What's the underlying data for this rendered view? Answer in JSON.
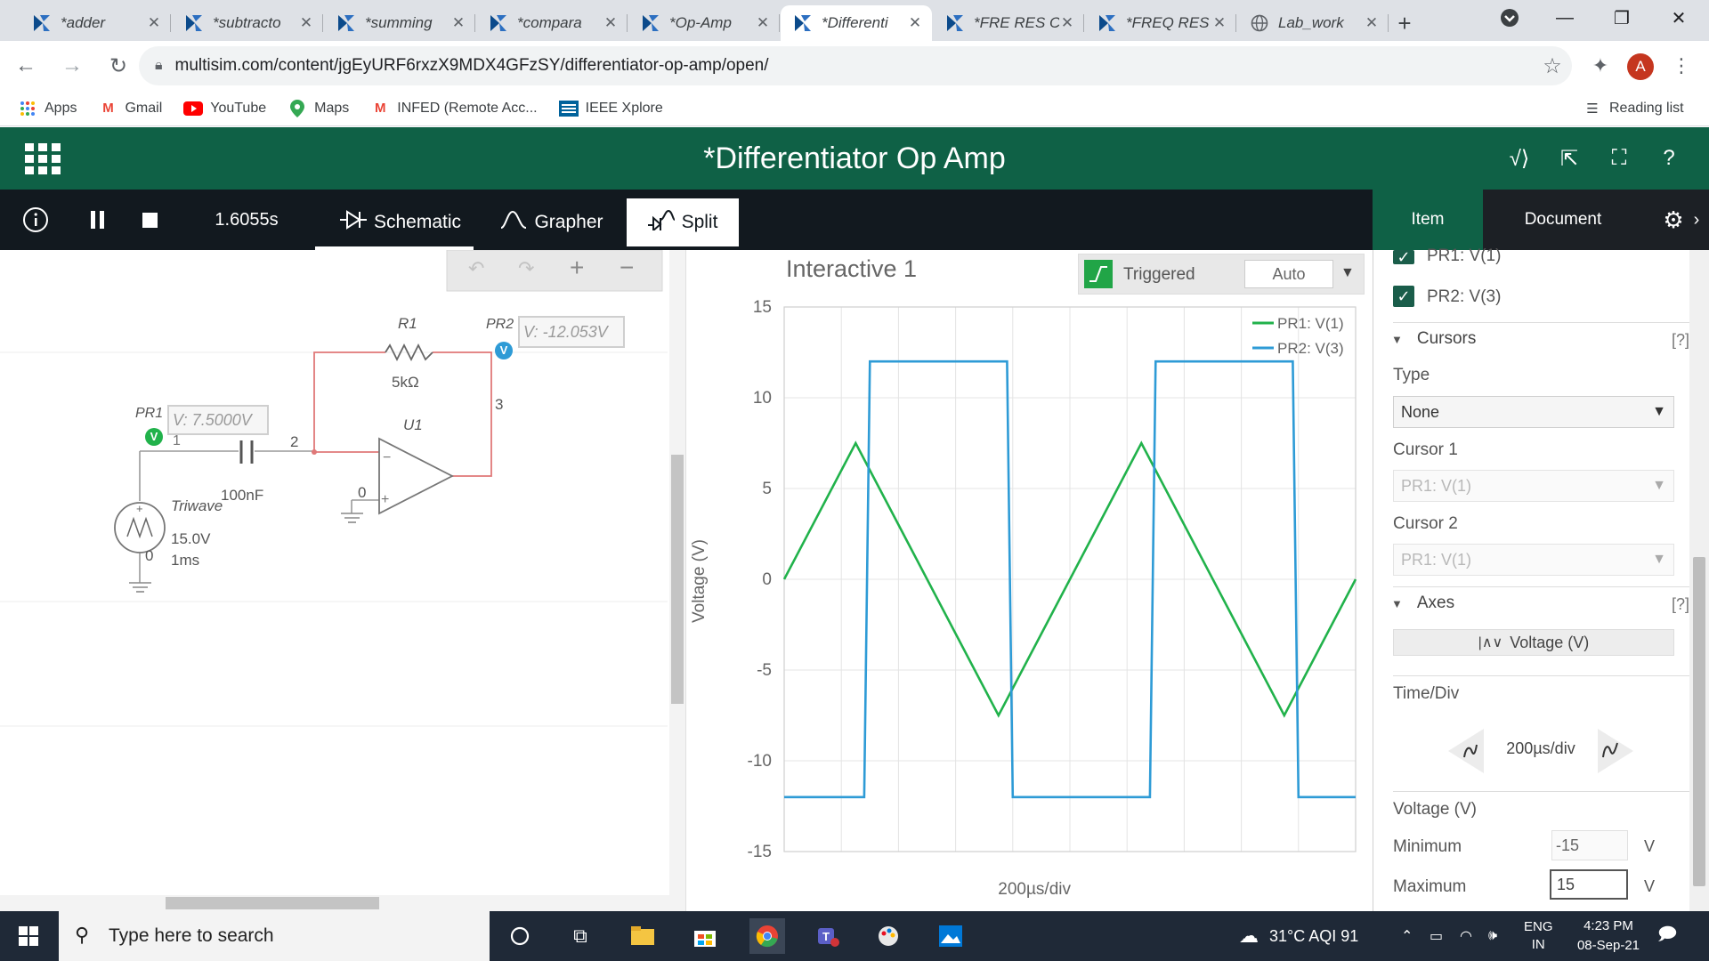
{
  "browser": {
    "tabs": [
      {
        "title": "*adder",
        "icon": "multisim-icon"
      },
      {
        "title": "*subtracto",
        "icon": "multisim-icon"
      },
      {
        "title": "*summing",
        "icon": "multisim-icon"
      },
      {
        "title": "*compara",
        "icon": "multisim-icon"
      },
      {
        "title": "*Op-Amp",
        "icon": "multisim-icon"
      },
      {
        "title": "*Differenti",
        "icon": "multisim-icon",
        "active": true
      },
      {
        "title": "*FRE RES C",
        "icon": "multisim-icon"
      },
      {
        "title": "*FREQ RES",
        "icon": "multisim-icon"
      },
      {
        "title": "Lab_work",
        "icon": "globe-icon"
      }
    ],
    "url": "multisim.com/content/jgEyURF6rxzX9MDX4GFzSY/differentiator-op-amp/open/",
    "profile_initial": "A",
    "bookmarks": {
      "apps": "Apps",
      "gmail": "Gmail",
      "youtube": "YouTube",
      "maps": "Maps",
      "infed": "INFED (Remote Acc...",
      "ieee": "IEEE Xplore",
      "reading_list": "Reading list"
    }
  },
  "app": {
    "title": "Differentiator Op Amp",
    "title_prefix": "*",
    "sim_time": "1.6055s",
    "views": {
      "schematic": "Schematic",
      "grapher": "Grapher",
      "split": "Split"
    },
    "side_tabs": {
      "item": "Item",
      "document": "Document"
    }
  },
  "schematic": {
    "r1_label": "R1",
    "r1_value": "5kΩ",
    "c_value": "100nF",
    "u1_label": "U1",
    "pr1_label": "PR1",
    "pr2_label": "PR2",
    "pr1_reading": "V: 7.5000V",
    "pr2_reading": "V: -12.053V",
    "node1": "1",
    "node2": "2",
    "node3": "3",
    "node0a": "0",
    "node0b": "0",
    "source_name": "Triwave",
    "source_amp": "15.0V",
    "source_period": "1ms",
    "probe_glyph": "V"
  },
  "graph": {
    "title": "Interactive 1",
    "trigger_label": "Triggered",
    "trigger_mode": "Auto",
    "ylabel": "Voltage (V)",
    "xlabel": "200µs/div",
    "legend": [
      "PR1: V(1)",
      "PR2: V(3)"
    ],
    "colors": {
      "pr1": "#21b24b",
      "pr2": "#2e9bd6"
    }
  },
  "chart_data": {
    "type": "line",
    "title": "Interactive 1",
    "xlabel": "200µs/div",
    "ylabel": "Voltage (V)",
    "ylim": [
      -15,
      15
    ],
    "yticks": [
      15,
      10,
      5,
      0,
      -5,
      -10,
      -15
    ],
    "xlim": [
      0,
      2000
    ],
    "x_unit": "µs",
    "grid": true,
    "legend_position": "top-right",
    "series": [
      {
        "name": "PR1: V(1)",
        "x": [
          0,
          250,
          750,
          1250,
          1750,
          2000
        ],
        "y": [
          0,
          7.5,
          -7.5,
          7.5,
          -7.5,
          0
        ]
      },
      {
        "name": "PR2: V(3)",
        "x": [
          0,
          280,
          300,
          780,
          800,
          1280,
          1300,
          1780,
          1800,
          2000
        ],
        "y": [
          -12,
          -12,
          12,
          12,
          -12,
          -12,
          12,
          12,
          -12,
          -12
        ]
      }
    ]
  },
  "panel": {
    "traces": [
      "PR1: V(1)",
      "PR2: V(3)"
    ],
    "cursors_label": "Cursors",
    "help": "[?]",
    "type_label": "Type",
    "type_value": "None",
    "cursor1_label": "Cursor 1",
    "cursor1_value": "PR1: V(1)",
    "cursor2_label": "Cursor 2",
    "cursor2_value": "PR1: V(1)",
    "axes_label": "Axes",
    "axes_button": "Voltage (V)",
    "timediv_label": "Time/Div",
    "timediv_value": "200µs/div",
    "voltage_label": "Voltage (V)",
    "min_label": "Minimum",
    "min_value": "-15",
    "max_label": "Maximum",
    "max_value": "15",
    "unit": "V"
  },
  "taskbar": {
    "search_placeholder": "Type here to search",
    "weather": "31°C  AQI 91",
    "lang_top": "ENG",
    "lang_bottom": "IN",
    "time": "4:23 PM",
    "date": "08-Sep-21"
  }
}
